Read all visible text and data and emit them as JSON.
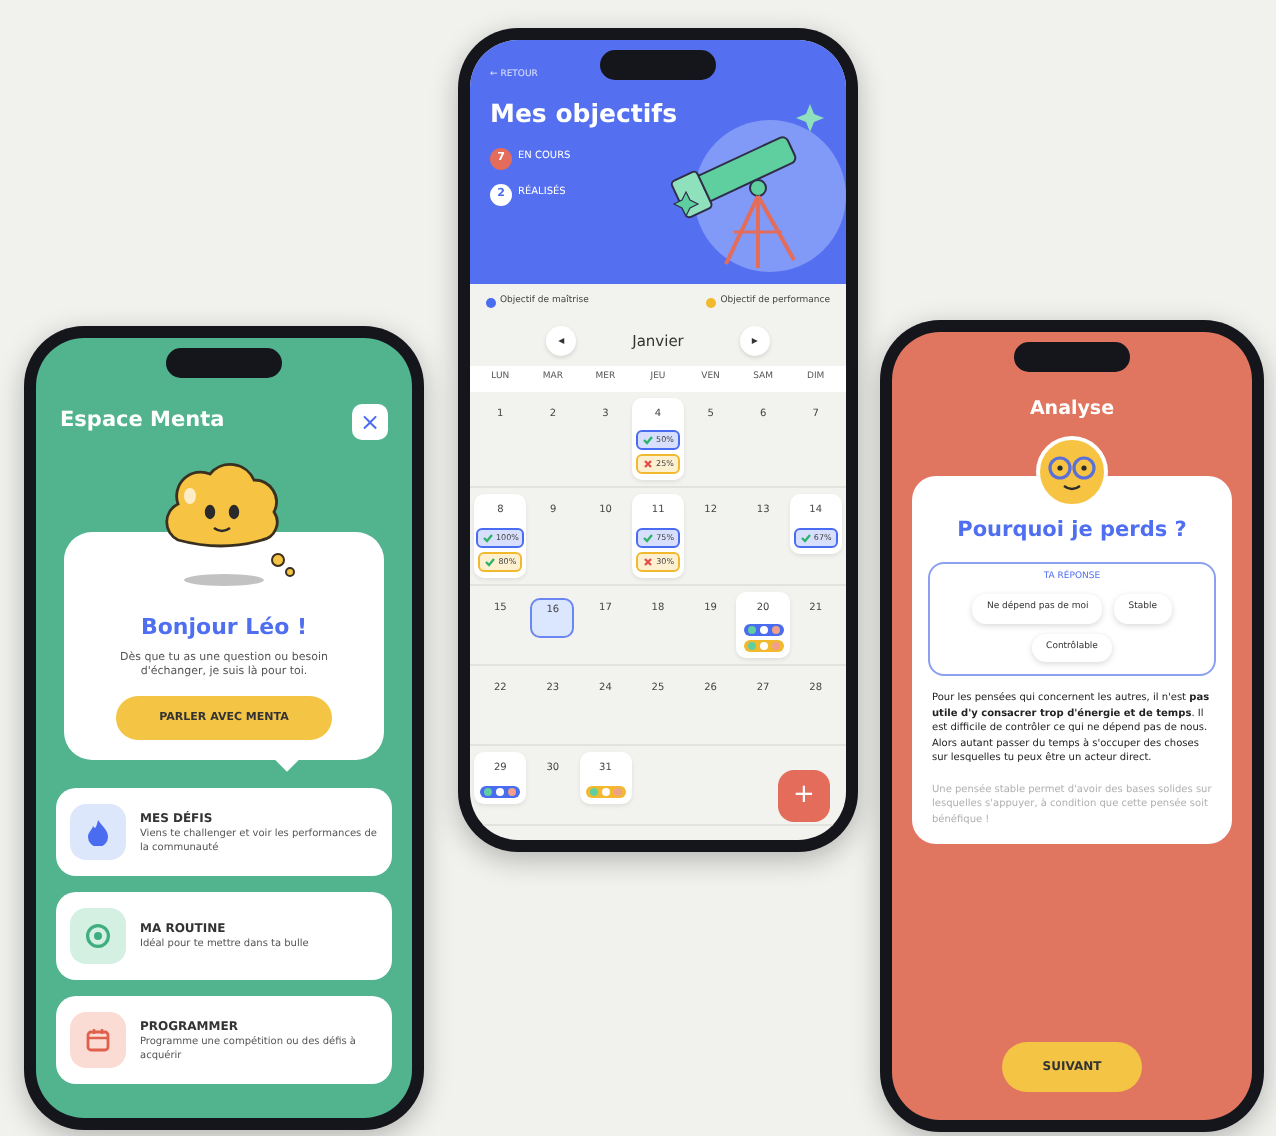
{
  "phones": [
    {
      "kind": "menta",
      "title": "Espace Menta",
      "close": "×",
      "greeting": "Bonjour Léo !",
      "message": "Dès que tu as une question ou besoin d'échanger, je suis là pour toi.",
      "button": "PARLER AVEC MENTA",
      "items": [
        {
          "kind": "defis",
          "title": "MES DÉFIS",
          "text": "Viens te challenger et voir les performances de la communauté"
        },
        {
          "kind": "routine",
          "title": "MA ROUTINE",
          "text": "Idéal pour te mettre dans ta bulle"
        },
        {
          "kind": "programmer",
          "title": "PROGRAMMER",
          "text": "Programme une compétition ou des défis à acquérir"
        }
      ]
    },
    {
      "kind": "objectifs",
      "back": "← RETOUR",
      "title": "Mes objectifs",
      "stats": [
        {
          "kind": "current",
          "count": "7",
          "label": "EN COURS"
        },
        {
          "kind": "done",
          "count": "2",
          "label": "RÉALISÉS"
        }
      ],
      "legend": [
        {
          "label": "Objectif de maîtrise",
          "color": "#4a6cf0"
        },
        {
          "label": "Objectif de performance",
          "color": "#f2b92f"
        }
      ],
      "prev": "◂",
      "month": "Janvier",
      "next": "▸",
      "weekdays": [
        "LUN",
        "MAR",
        "MER",
        "JEU",
        "VEN",
        "SAM",
        "DIM"
      ],
      "weeks": [
        [
          {
            "day": "1",
            "selected": false
          },
          {
            "day": "2",
            "selected": false
          },
          {
            "day": "3",
            "selected": false
          },
          {
            "day": "4",
            "selected": false,
            "badges": [
              {
                "kind": "score",
                "color": "#4a6cf0",
                "done": true,
                "text": "50%"
              },
              {
                "kind": "score",
                "color": "#f2b92f",
                "done": false,
                "text": "25%"
              }
            ]
          },
          {
            "day": "5",
            "selected": false
          },
          {
            "day": "6",
            "selected": false
          },
          {
            "day": "7",
            "selected": false
          }
        ],
        [
          {
            "day": "8",
            "selected": false,
            "badges": [
              {
                "kind": "score",
                "color": "#4a6cf0",
                "done": true,
                "text": "100%"
              },
              {
                "kind": "score",
                "color": "#f2b92f",
                "done": true,
                "text": "80%"
              }
            ]
          },
          {
            "day": "9",
            "selected": false
          },
          {
            "day": "10",
            "selected": false
          },
          {
            "day": "11",
            "selected": false,
            "badges": [
              {
                "kind": "score",
                "color": "#4a6cf0",
                "done": true,
                "text": "75%"
              },
              {
                "kind": "score",
                "color": "#f2b92f",
                "done": false,
                "text": "30%"
              }
            ]
          },
          {
            "day": "12",
            "selected": false
          },
          {
            "day": "13",
            "selected": false
          },
          {
            "day": "14",
            "selected": false,
            "badges": [
              {
                "kind": "score",
                "color": "#4a6cf0",
                "done": true,
                "text": "67%"
              }
            ]
          }
        ],
        [
          {
            "day": "15",
            "selected": false
          },
          {
            "day": "16",
            "selected": true
          },
          {
            "day": "17",
            "selected": false
          },
          {
            "day": "18",
            "selected": false
          },
          {
            "day": "19",
            "selected": false
          },
          {
            "day": "20",
            "selected": false,
            "badges": [
              {
                "kind": "chip",
                "color": "#4a6cf0"
              },
              {
                "kind": "chip",
                "color": "#f2b92f"
              }
            ]
          },
          {
            "day": "21",
            "selected": false
          }
        ],
        [
          {
            "day": "22",
            "selected": false
          },
          {
            "day": "23",
            "selected": false
          },
          {
            "day": "24",
            "selected": false
          },
          {
            "day": "25",
            "selected": false
          },
          {
            "day": "26",
            "selected": false
          },
          {
            "day": "27",
            "selected": false
          },
          {
            "day": "28",
            "selected": false
          }
        ],
        [
          {
            "day": "29",
            "selected": false,
            "badges": [
              {
                "kind": "chip",
                "color": "#4a6cf0"
              }
            ]
          },
          {
            "day": "30",
            "selected": false
          },
          {
            "day": "31",
            "selected": false,
            "badges": [
              {
                "kind": "chip",
                "color": "#f2b92f"
              }
            ]
          }
        ]
      ],
      "add": "+"
    },
    {
      "kind": "analyse",
      "title": "Analyse",
      "question": "Pourquoi je perds ?",
      "answer_label": "TA RÉPONSE",
      "answers": [
        "Ne dépend pas de moi",
        "Stable",
        "Contrôlable"
      ],
      "paragraphs": [
        {
          "faded": false,
          "text": "Pour les pensées qui concernent les autres, il n'est **pas utile d'y consacrer trop d'énergie et de temps**. Il est difficile de contrôler ce qui ne dépend pas de nous. Alors autant passer du temps à s'occuper des choses sur lesquelles tu peux être un acteur direct."
        },
        {
          "faded": true,
          "text": "Une pensée stable permet d'avoir des bases solides sur lesquelles s'appuyer, à condition que cette pensée soit bénéfique !"
        }
      ],
      "button": "SUIVANT"
    }
  ]
}
